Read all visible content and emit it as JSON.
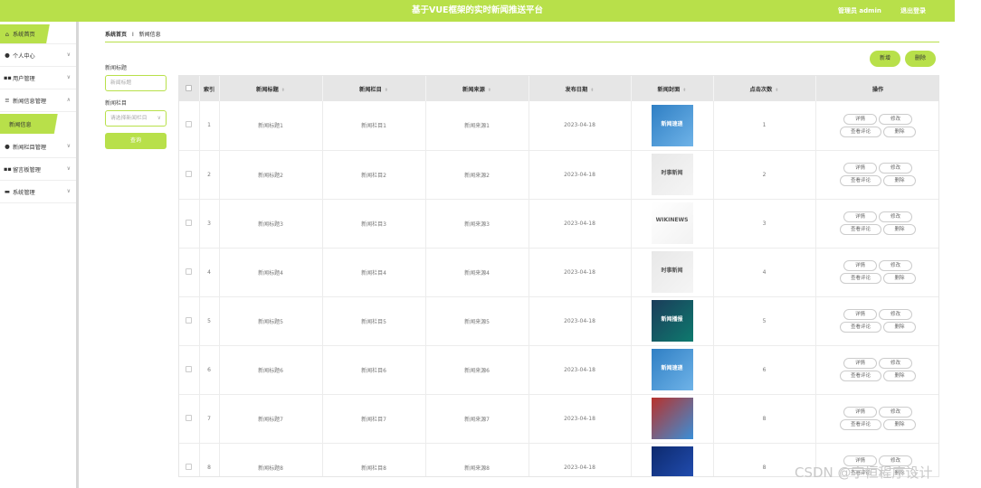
{
  "header": {
    "title": "基于VUE框架的实时新闻推送平台",
    "admin": "管理员 admin",
    "logout": "退出登录"
  },
  "sidebar": {
    "items": [
      {
        "label": "系统首页",
        "icon": "home-icon"
      },
      {
        "label": "个人中心",
        "icon": "user-icon"
      },
      {
        "label": "用户管理",
        "icon": "grid-icon"
      },
      {
        "label": "新闻信息管理",
        "icon": "list-icon"
      },
      {
        "label": "新闻栏目管理",
        "icon": "user-icon"
      },
      {
        "label": "留言板管理",
        "icon": "grid-icon"
      },
      {
        "label": "系统管理",
        "icon": "monitor-icon"
      }
    ],
    "sub_item": "新闻信息"
  },
  "breadcrumb": {
    "home": "系统首页",
    "sep": "Ⅰ",
    "current": "新闻信息"
  },
  "search": {
    "title_label": "新闻标题",
    "title_placeholder": "新闻标题",
    "column_label": "新闻栏目",
    "column_placeholder": "请选择新闻栏目",
    "button": "查询"
  },
  "actions": {
    "add": "新增",
    "delete": "删除"
  },
  "table": {
    "headers": [
      "索引",
      "新闻标题",
      "新闻栏目",
      "新闻来源",
      "发布日期",
      "新闻封面",
      "点击次数",
      "操作"
    ],
    "rows": [
      {
        "index": "1",
        "title": "新闻标题1",
        "column": "新闻栏目1",
        "source": "新闻来源1",
        "date": "2023-04-18",
        "clicks": "1",
        "cover": "新闻速递"
      },
      {
        "index": "2",
        "title": "新闻标题2",
        "column": "新闻栏目2",
        "source": "新闻来源2",
        "date": "2023-04-18",
        "clicks": "2",
        "cover": "时事新闻"
      },
      {
        "index": "3",
        "title": "新闻标题3",
        "column": "新闻栏目3",
        "source": "新闻来源3",
        "date": "2023-04-18",
        "clicks": "3",
        "cover": "WIKINEWS"
      },
      {
        "index": "4",
        "title": "新闻标题4",
        "column": "新闻栏目4",
        "source": "新闻来源4",
        "date": "2023-04-18",
        "clicks": "4",
        "cover": "时事新闻"
      },
      {
        "index": "5",
        "title": "新闻标题5",
        "column": "新闻栏目5",
        "source": "新闻来源5",
        "date": "2023-04-18",
        "clicks": "5",
        "cover": "新闻播报"
      },
      {
        "index": "6",
        "title": "新闻标题6",
        "column": "新闻栏目6",
        "source": "新闻来源6",
        "date": "2023-04-18",
        "clicks": "6",
        "cover": "新闻速递"
      },
      {
        "index": "7",
        "title": "新闻标题7",
        "column": "新闻栏目7",
        "source": "新闻来源7",
        "date": "2023-04-18",
        "clicks": "8",
        "cover": ""
      },
      {
        "index": "8",
        "title": "新闻标题8",
        "column": "新闻栏目8",
        "source": "新闻来源8",
        "date": "2023-04-18",
        "clicks": "8",
        "cover": ""
      }
    ],
    "row_actions": {
      "detail": "详情",
      "edit": "修改",
      "comments": "查看评论",
      "delete": "删除"
    }
  },
  "watermark": "CSDN @宇恒程序设计",
  "colors": {
    "accent": "#b8e04a",
    "header_bg": "#b8e04a"
  }
}
